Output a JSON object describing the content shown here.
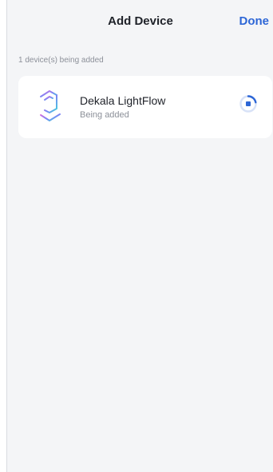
{
  "header": {
    "title": "Add Device",
    "done_label": "Done"
  },
  "section": {
    "label": "1 device(s) being added"
  },
  "devices": [
    {
      "name": "Dekala LightFlow",
      "status": "Being added",
      "icon": "lightflow-logo-icon",
      "progress_icon": "loading-spinner-icon"
    }
  ],
  "colors": {
    "background": "#f4f5f7",
    "card": "#ffffff",
    "accent": "#2d66d6",
    "title": "#1f2229",
    "muted": "#8c9099"
  }
}
